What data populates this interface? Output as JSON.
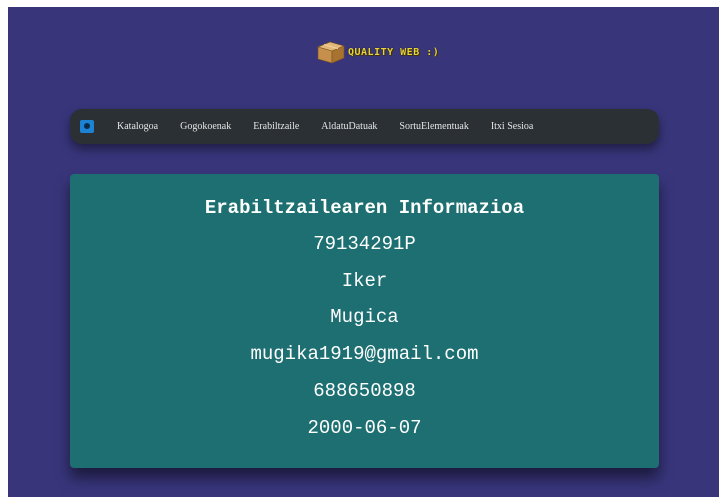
{
  "logo": {
    "text": "QUALITY WEB :)",
    "icon": "box-icon"
  },
  "navbar": {
    "brand_icon": "brand-icon",
    "links": [
      "Katalogoa",
      "Gogokoenak",
      "Erabiltzaile",
      "AldatuDatuak",
      "SortuElementuak",
      "Itxi Sesioa"
    ]
  },
  "user_info": {
    "title": "Erabiltzailearen Informazioa",
    "dni": "79134291P",
    "name": "Iker",
    "surname": "Mugica",
    "email": "mugika1919@gmail.com",
    "phone": "688650898",
    "birthdate": "2000-06-07"
  },
  "colors": {
    "background": "#38357b",
    "navbar": "#2b3034",
    "card": "#1d6f71",
    "logo_text": "#e9d33b"
  }
}
